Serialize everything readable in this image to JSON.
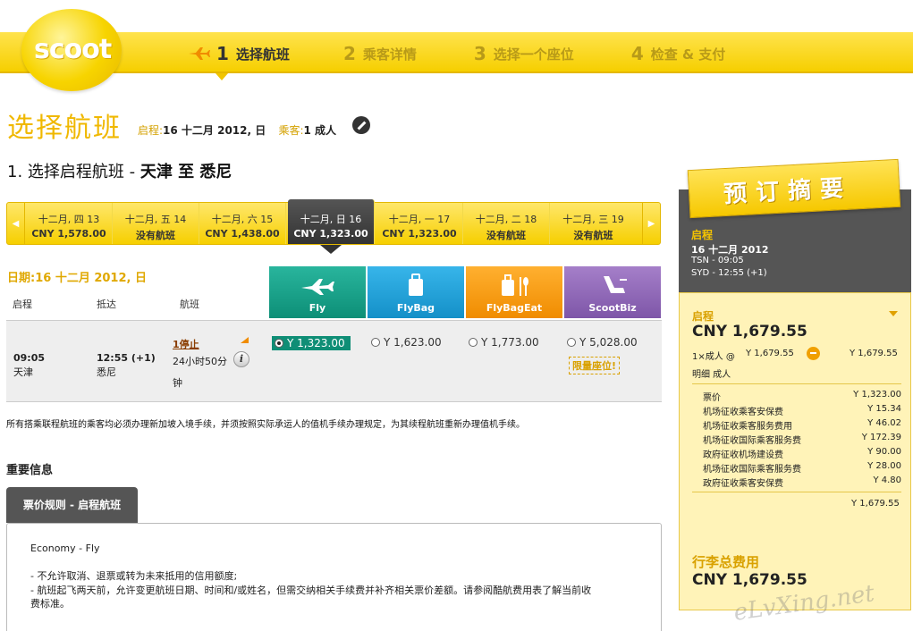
{
  "brand": {
    "logo_text": "scoot",
    "accent": "#f6cf00",
    "dark": "#555555"
  },
  "steps": [
    {
      "num": "1",
      "label": "选择航班"
    },
    {
      "num": "2",
      "label": "乘客详情"
    },
    {
      "num": "3",
      "label": "选择一个座位"
    },
    {
      "num": "4",
      "label": "检查 & 支付"
    }
  ],
  "title": {
    "main": "选择航班",
    "depart_label": "启程:",
    "depart_value": "16 十二月 2012, 日",
    "pax_label": "乘客:",
    "pax_value": "1 成人"
  },
  "section": {
    "prefix": "1. 选择启程航班 - ",
    "route": "天津  至  悉尼"
  },
  "dates": [
    {
      "day": "十二月, 四 13",
      "price": "CNY 1,578.00"
    },
    {
      "day": "十二月, 五 14",
      "price": "没有航班"
    },
    {
      "day": "十二月, 六 15",
      "price": "CNY 1,438.00"
    },
    {
      "day": "十二月, 日 16",
      "price": "CNY 1,323.00"
    },
    {
      "day": "十二月, 一 17",
      "price": "CNY 1,323.00"
    },
    {
      "day": "十二月, 二 18",
      "price": "没有航班"
    },
    {
      "day": "十二月, 三 19",
      "price": "没有航班"
    }
  ],
  "date_label": "日期:16 十二月 2012, 日",
  "columns": {
    "depart": "启程",
    "arrive": "抵达",
    "flight": "航班"
  },
  "fare_tabs": [
    "Fly",
    "FlyBag",
    "FlyBagEat",
    "ScootBiz"
  ],
  "flight": {
    "dep_time": "09:05",
    "dep_city": "天津",
    "arr_time": "12:55 (+1)",
    "arr_city": "悉尼",
    "stops": "1停止",
    "duration_a": "24小时50分",
    "duration_b": "钟",
    "info": "i",
    "fares": [
      "Y 1,323.00",
      "Y 1,623.00",
      "Y 1,773.00",
      "Y 5,028.00"
    ],
    "limited": "限量座位!"
  },
  "notice": "所有搭乘联程航班的乘客均必须办理新加坡入境手续，并须按照实际承运人的值机手续办理规定，为其续程航班重新办理值机手续。",
  "important_heading": "重要信息",
  "rule_tab": "票价规则 - 启程航班",
  "rules": {
    "fare_class": "Economy - Fly",
    "line1": "- 不允许取消、退票或转为未来抵用的信用额度;",
    "line2": "- 航班起飞两天前，允许变更航班日期、时间和/或姓名，但需交纳相关手续费并补齐相关票价差额。请参阅酷航费用表了解当前收",
    "line3": "费标准。"
  },
  "summary": {
    "banner": "预订摘要",
    "depart_label": "启程",
    "date": "16 十二月 2012",
    "from": "TSN - 09:05",
    "to": "SYD - 12:55 (+1)",
    "panel_label": "启程",
    "panel_total": "CNY 1,679.55",
    "pax_line": "1×成人 @",
    "pax_price": "Y 1,679.55",
    "pax_total": "Y 1,679.55",
    "detail_label": "明细 成人",
    "items": [
      {
        "name": "票价",
        "value": "Y 1,323.00"
      },
      {
        "name": "机场征收乘客安保费",
        "value": "Y 15.34"
      },
      {
        "name": "机场征收乘客服务费用",
        "value": "Y 46.02"
      },
      {
        "name": "机场征收国际乘客服务费",
        "value": "Y 172.39"
      },
      {
        "name": "政府征收机场建设费",
        "value": "Y 90.00"
      },
      {
        "name": "机场征收国际乘客服务费",
        "value": "Y 28.00"
      },
      {
        "name": "政府征收乘客安保费",
        "value": "Y 4.80"
      }
    ],
    "subtotal": "Y 1,679.55",
    "grand_label": "行李总费用",
    "grand_total": "CNY 1,679.55"
  },
  "watermark": "eLvXing.net"
}
